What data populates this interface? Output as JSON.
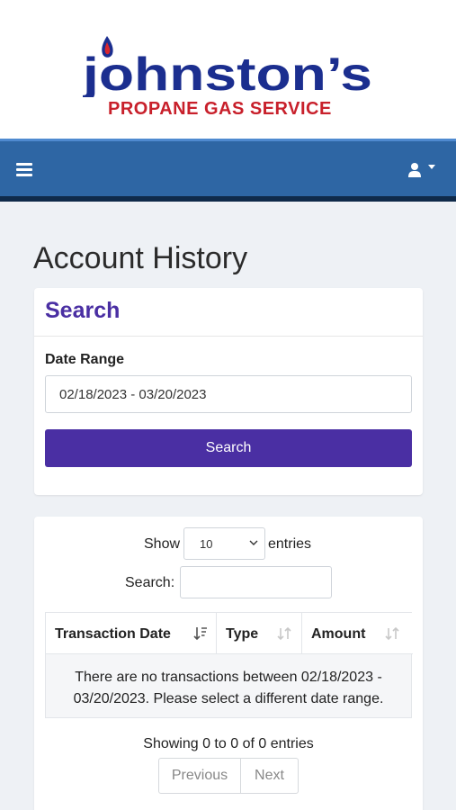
{
  "brand": {
    "name": "Johnston's",
    "tagline": "PROPANE GAS SERVICE",
    "colors": {
      "name": "#1b2e8f",
      "tagline": "#c8202b",
      "flame_blue": "#1b2e8f",
      "flame_red": "#d8262e"
    }
  },
  "navbar": {
    "menu_icon": "hamburger-icon",
    "user_icon": "user-icon",
    "caret_icon": "caret-down-icon",
    "color": "#2e66a4"
  },
  "page": {
    "title": "Account History"
  },
  "search_card": {
    "heading": "Search",
    "date_range_label": "Date Range",
    "date_range_value": "02/18/2023 - 03/20/2023",
    "search_button": "Search",
    "accent": "#4a2fa3"
  },
  "table_card": {
    "show_label": "Show",
    "entries_value": "10",
    "entries_label": "entries",
    "search_label": "Search:",
    "search_value": "",
    "columns": [
      "Transaction Date",
      "Type",
      "Amount"
    ],
    "empty_message": "There are no transactions between 02/18/2023 - 03/20/2023. Please select a different date range.",
    "info": "Showing 0 to 0 of 0 entries",
    "previous": "Previous",
    "next": "Next"
  }
}
